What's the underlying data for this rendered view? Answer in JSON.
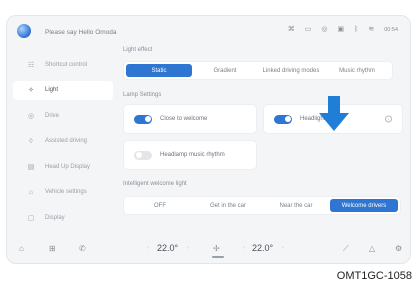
{
  "topbar": {
    "greeting": "Please say Hello Omoda",
    "clock": "00:54",
    "status_icons": [
      "fan-icon",
      "phone-icon",
      "record-icon",
      "camera-icon",
      "bluetooth-icon",
      "wifi-icon",
      "clock"
    ]
  },
  "sidebar": {
    "items": [
      {
        "label": "Shortcut control",
        "icon": "shortcut-icon",
        "active": false
      },
      {
        "label": "Light",
        "icon": "light-icon",
        "active": true
      },
      {
        "label": "Drive",
        "icon": "drive-icon",
        "active": false
      },
      {
        "label": "Assisted driving",
        "icon": "assisted-driving-icon",
        "active": false
      },
      {
        "label": "Head Up Display",
        "icon": "hud-icon",
        "active": false
      },
      {
        "label": "Vehicle settings",
        "icon": "vehicle-icon",
        "active": false
      },
      {
        "label": "Display",
        "icon": "display-icon",
        "active": false
      }
    ]
  },
  "light_effect": {
    "label": "Light effect",
    "options": [
      "Static",
      "Gradient",
      "Linked driving modes",
      "Music rhythm"
    ],
    "selected": "Static"
  },
  "lamp_settings": {
    "label": "Lamp Settings",
    "close_to_welcome": {
      "label": "Close to welcome",
      "on": true
    },
    "headlight_delay": {
      "label": "Headlight delay",
      "on": true,
      "info": "i"
    },
    "headlamp_music_rhythm": {
      "label": "Headlamp music rhythm",
      "on": false
    }
  },
  "welcome_light": {
    "label": "Intelligent welcome light",
    "options": [
      "OFF",
      "Get in the car",
      "Near the car",
      "Welcome drivers"
    ],
    "selected": "Welcome drivers"
  },
  "bottombar": {
    "left_temp": "22.0°",
    "right_temp": "22.0°",
    "temp_left_arrow": "‹",
    "temp_right_arrow": "›"
  },
  "caption": "OMT1GC-1058",
  "colors": {
    "accent": "#2e76d2",
    "arrow": "#1f7fd6"
  }
}
